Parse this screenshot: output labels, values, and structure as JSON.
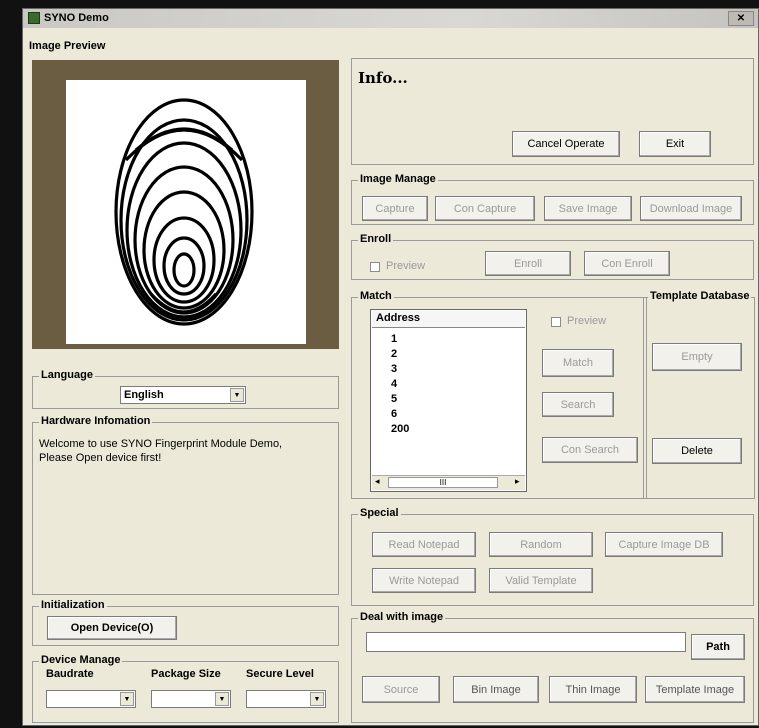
{
  "window": {
    "title": "SYNO Demo",
    "close_glyph": "✕"
  },
  "image_preview": {
    "label": "Image Preview"
  },
  "info": {
    "title": "Info...",
    "cancel_operate": "Cancel Operate",
    "exit": "Exit"
  },
  "image_manage": {
    "label": "Image Manage",
    "capture": "Capture",
    "con_capture": "Con Capture",
    "save_image": "Save Image",
    "download_image": "Download Image"
  },
  "enroll": {
    "label": "Enroll",
    "preview": "Preview",
    "enroll": "Enroll",
    "con_enroll": "Con Enroll"
  },
  "match": {
    "label": "Match",
    "list_header": "Address",
    "items": [
      "1",
      "2",
      "3",
      "4",
      "5",
      "6",
      "200"
    ],
    "scroll_thumb": "III",
    "preview": "Preview",
    "match": "Match",
    "search": "Search",
    "con_search": "Con Search"
  },
  "template_db": {
    "label": "Template Database",
    "empty": "Empty",
    "delete": "Delete"
  },
  "language": {
    "label": "Language",
    "selected": "English"
  },
  "hardware": {
    "label": "Hardware Infomation",
    "line1": "Welcome to use SYNO Fingerprint Module Demo,",
    "line2": "Please Open device first!"
  },
  "initialization": {
    "label": "Initialization",
    "open_device": "Open Device(O)"
  },
  "device_manage": {
    "label": "Device Manage",
    "baudrate": "Baudrate",
    "package_size": "Package Size",
    "secure_level": "Secure Level"
  },
  "special": {
    "label": "Special",
    "read_notepad": "Read Notepad",
    "random": "Random",
    "capture_image_db": "Capture Image DB",
    "write_notepad": "Write Notepad",
    "valid_template": "Valid Template"
  },
  "deal_image": {
    "label": "Deal with image",
    "path": "Path",
    "source": "Source",
    "bin_image": "Bin Image",
    "thin_image": "Thin Image",
    "template_image": "Template Image"
  },
  "colors": {
    "window_bg": "#ece9d8",
    "preview_frame": "#6b5d41",
    "title_bar": "#d0cfcb"
  },
  "icons": {
    "app": "fingerprint-app-icon",
    "dropdown": "chevron-down-icon"
  }
}
